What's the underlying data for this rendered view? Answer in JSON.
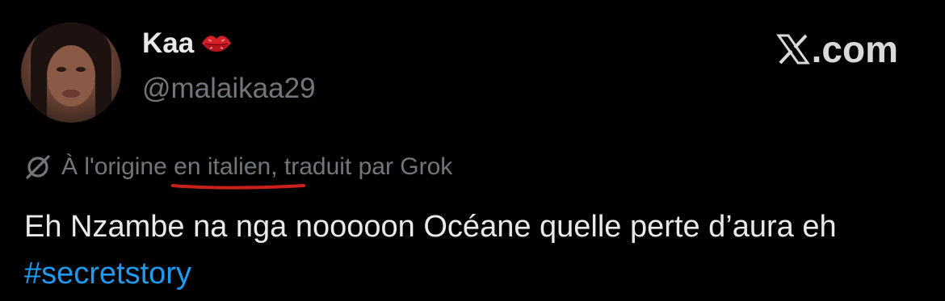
{
  "author": {
    "display_name": "Kaa",
    "display_name_emoji": "lips-emoji-icon",
    "handle": "@malaikaa29"
  },
  "brand": {
    "logo_icon": "x-logo-icon",
    "domain_text": ".com"
  },
  "translation": {
    "icon": "translate-icon",
    "text": "À l'origine en italien, traduit par Grok"
  },
  "tweet": {
    "text": "Eh Nzambe na nga nooooon Océane quelle perte d’aura eh ",
    "hashtag": "#secretstory"
  },
  "colors": {
    "background": "#000000",
    "primary_text": "#e7e9ea",
    "secondary_text": "#71767b",
    "link": "#1d9bf0",
    "annotation_underline": "#c8211c"
  }
}
